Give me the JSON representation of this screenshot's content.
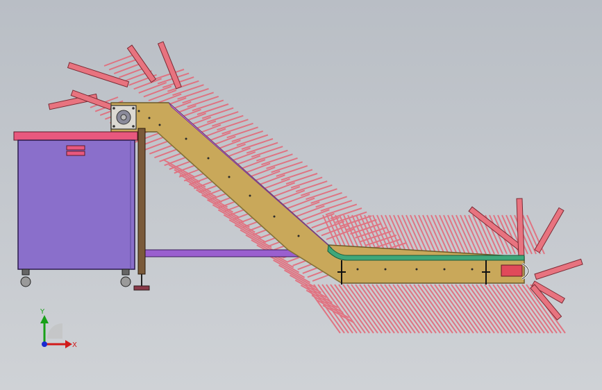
{
  "viewport": {
    "background_top": "#b9bec5",
    "background_bottom": "#cfd2d6"
  },
  "colors": {
    "bin_body": "#8a6fcb",
    "bin_lid": "#e8587e",
    "frame": "#c9a85a",
    "frame_edge": "#6a5a2a",
    "belt_cleats": "#e36b7a",
    "belt_top_incline": "#d88ae0",
    "belt_top_flat": "#3fa77a",
    "support_bar": "#9a5fcf",
    "post": "#7a5a3a"
  },
  "triad": {
    "x_label": "X",
    "y_label": "Y",
    "x_color": "#d11a1a",
    "y_color": "#18a018",
    "z_color": "#1a2ad1"
  }
}
